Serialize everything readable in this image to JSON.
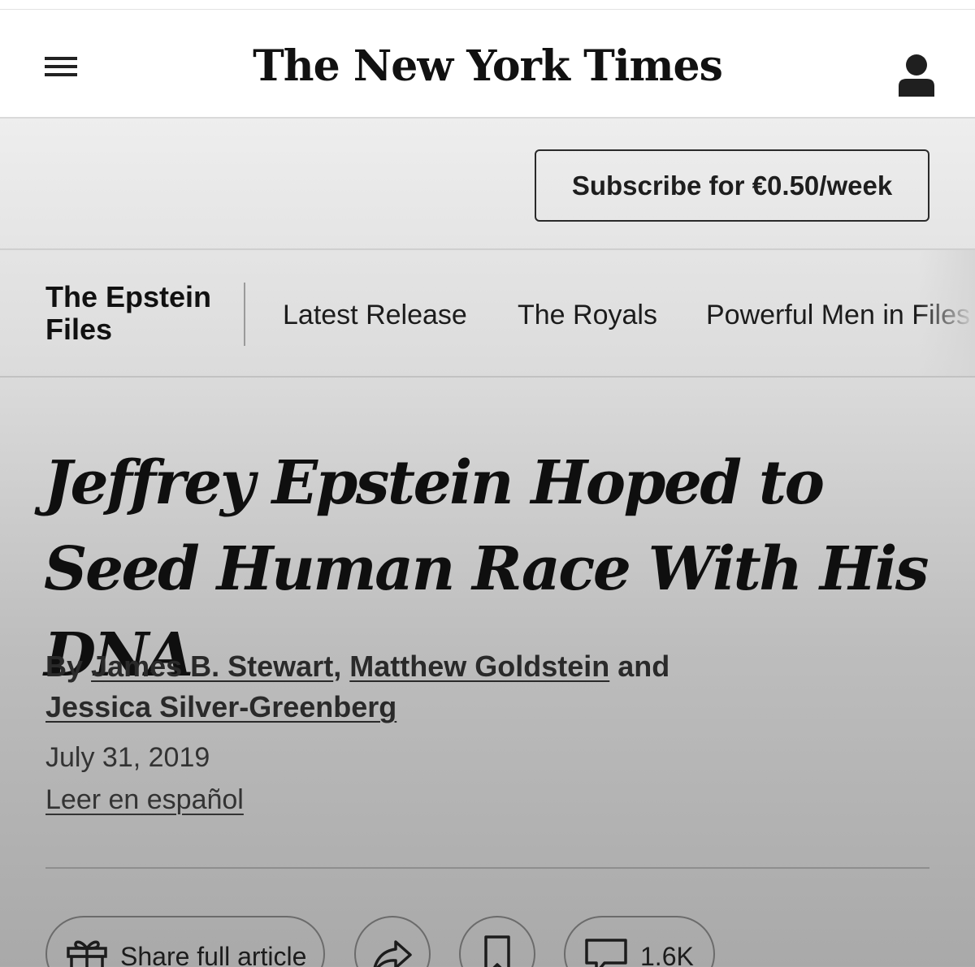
{
  "header": {
    "logo_text": "The New York Times"
  },
  "subscribe": {
    "label": "Subscribe for €0.50/week"
  },
  "section_nav": {
    "title": "The Epstein Files",
    "links": [
      "Latest Release",
      "The Royals",
      "Powerful Men in Files"
    ]
  },
  "article": {
    "headline": "Jeffrey Epstein Hoped to Seed Human Race With His DNA",
    "byline": {
      "prefix": "By",
      "authors": [
        "James B. Stewart",
        "Matthew Goldstein",
        "Jessica Silver-Greenberg"
      ],
      "separator": ",",
      "conjunction": "and"
    },
    "date": "July 31, 2019",
    "translation_link": "Leer en español"
  },
  "actions": {
    "share_label": "Share full article",
    "comments_count": "1.6K",
    "icons": [
      "gift-icon",
      "forward-arrow-icon",
      "bookmark-icon",
      "comment-bubble-icon"
    ]
  },
  "colors": {
    "text": "#1a1a1a",
    "header_bg": "#ffffff",
    "border": "#2a2a2a"
  }
}
